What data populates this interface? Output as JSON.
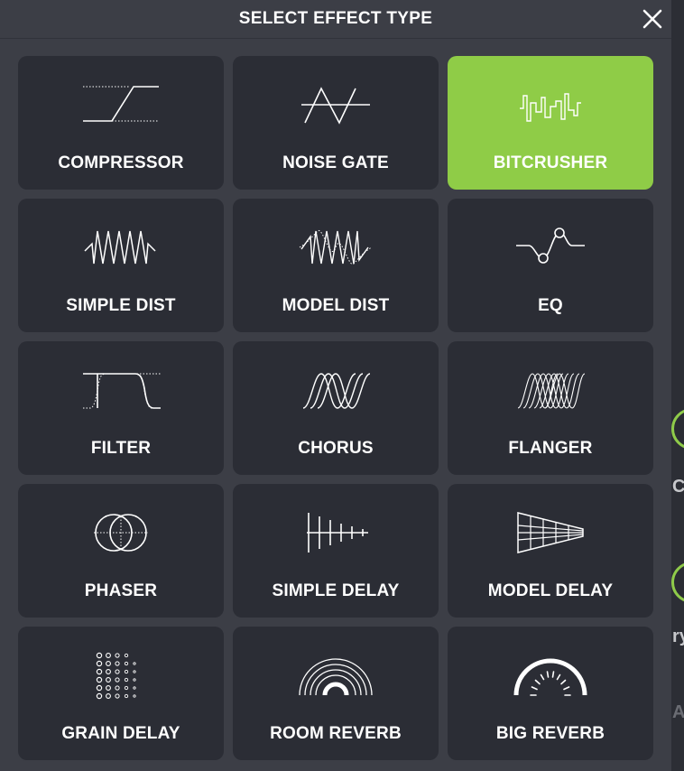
{
  "dialog": {
    "title": "SELECT EFFECT TYPE",
    "close_icon": "close-icon"
  },
  "accent_color": "#8fcc47",
  "selected_effect": "BITCRUSHER",
  "effects": [
    {
      "label": "COMPRESSOR",
      "icon": "compressor-icon"
    },
    {
      "label": "NOISE GATE",
      "icon": "noise-gate-icon"
    },
    {
      "label": "BITCRUSHER",
      "icon": "bitcrusher-icon"
    },
    {
      "label": "SIMPLE DIST",
      "icon": "simple-dist-icon"
    },
    {
      "label": "MODEL DIST",
      "icon": "model-dist-icon"
    },
    {
      "label": "EQ",
      "icon": "eq-icon"
    },
    {
      "label": "FILTER",
      "icon": "filter-icon"
    },
    {
      "label": "CHORUS",
      "icon": "chorus-icon"
    },
    {
      "label": "FLANGER",
      "icon": "flanger-icon"
    },
    {
      "label": "PHASER",
      "icon": "phaser-icon"
    },
    {
      "label": "SIMPLE DELAY",
      "icon": "simple-delay-icon"
    },
    {
      "label": "MODEL DELAY",
      "icon": "model-delay-icon"
    },
    {
      "label": "GRAIN DELAY",
      "icon": "grain-delay-icon"
    },
    {
      "label": "ROOM REVERB",
      "icon": "room-reverb-icon"
    },
    {
      "label": "BIG REVERB",
      "icon": "big-reverb-icon"
    }
  ],
  "background": {
    "partial_letter_1": "C",
    "partial_letter_2": "ry",
    "partial_letter_3": "AT"
  }
}
